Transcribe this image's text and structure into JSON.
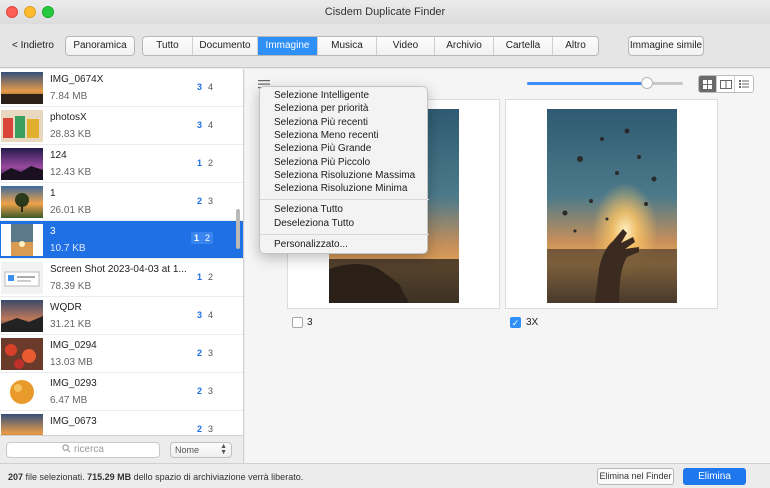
{
  "window": {
    "title": "Cisdem Duplicate Finder"
  },
  "toolbar": {
    "back_label": "< Indietro",
    "overview_label": "Panoramica",
    "tabs": [
      {
        "label": "Tutto",
        "active": false
      },
      {
        "label": "Documento",
        "active": false
      },
      {
        "label": "Immagine",
        "active": true
      },
      {
        "label": "Musica",
        "active": false
      },
      {
        "label": "Video",
        "active": false
      },
      {
        "label": "Archivio",
        "active": false
      },
      {
        "label": "Cartella",
        "active": false
      },
      {
        "label": "Altro",
        "active": false
      }
    ],
    "similar_label": "Immagine simile"
  },
  "file_list": [
    {
      "name": "IMG_0674X",
      "size": "7.84 MB",
      "badge_a": "3",
      "badge_b": "4",
      "selected": false,
      "thumb": "sunset-field"
    },
    {
      "name": "photosX",
      "size": "28.83 KB",
      "badge_a": "3",
      "badge_b": "4",
      "selected": false,
      "thumb": "colorful-crowd"
    },
    {
      "name": "124",
      "size": "12.43 KB",
      "badge_a": "1",
      "badge_b": "2",
      "selected": false,
      "thumb": "purple-night"
    },
    {
      "name": "1",
      "size": "26.01 KB",
      "badge_a": "2",
      "badge_b": "3",
      "selected": false,
      "thumb": "tree-sunset"
    },
    {
      "name": "3",
      "size": "10.7 KB",
      "badge_a": "1",
      "badge_b": "2",
      "selected": true,
      "thumb": "balloon-hand"
    },
    {
      "name": "Screen Shot 2023-04-03 at 1...",
      "size": "78.39 KB",
      "badge_a": "1",
      "badge_b": "2",
      "selected": false,
      "thumb": "screenshot"
    },
    {
      "name": "WQDR",
      "size": "31.21 KB",
      "badge_a": "3",
      "badge_b": "4",
      "selected": false,
      "thumb": "dusk-landscape"
    },
    {
      "name": "IMG_0294",
      "size": "13.03 MB",
      "badge_a": "2",
      "badge_b": "3",
      "selected": false,
      "thumb": "red-flowers"
    },
    {
      "name": "IMG_0293",
      "size": "6.47 MB",
      "badge_a": "2",
      "badge_b": "3",
      "selected": false,
      "thumb": "orange-fruit"
    },
    {
      "name": "IMG_0673",
      "size": "",
      "badge_a": "2",
      "badge_b": "3",
      "selected": false,
      "thumb": "sunset-field"
    }
  ],
  "search": {
    "placeholder": "ricerca"
  },
  "sort": {
    "selected": "Nome"
  },
  "zoom": {
    "level": 0.77
  },
  "view_mode": "grid",
  "preview": [
    {
      "label": "3",
      "checked": false
    },
    {
      "label": "3X",
      "checked": true
    }
  ],
  "context_menu": {
    "group1": [
      "Selezione Intelligente",
      "Seleziona per priorità",
      "Seleziona Più recenti",
      "Seleziona Meno recenti",
      "Seleziona Più Grande",
      "Seleziona Più Piccolo",
      "Seleziona Risoluzione Massima",
      "Seleziona Risoluzione Minima"
    ],
    "group2": [
      "Seleziona Tutto",
      "Deseleziona Tutto"
    ],
    "group3": [
      "Personalizzato..."
    ]
  },
  "status": {
    "count": "207",
    "count_text": " file selezionati. ",
    "size": "715.29 MB",
    "size_text": " dello spazio di archiviazione verrà liberato."
  },
  "actions": {
    "finder_label": "Elimina nel Finder",
    "delete_label": "Elimina"
  },
  "colors": {
    "accent": "#2e8ff7",
    "selection": "#1f6fe5",
    "delete": "#1f77ee"
  }
}
